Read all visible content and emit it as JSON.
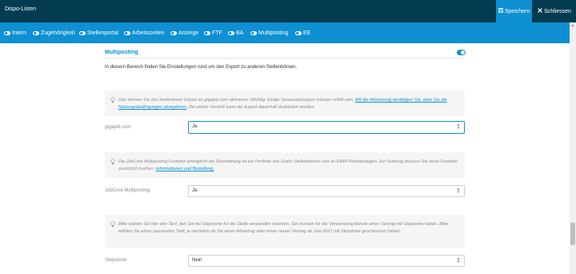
{
  "window": {
    "title": "Dispo-Listen",
    "save_label": "Speichern",
    "close_label": "Schliessen"
  },
  "tabs": [
    {
      "label": "Intern"
    },
    {
      "label": "Zugehörigkeit"
    },
    {
      "label": "Stellenportal"
    },
    {
      "label": "Arbeitszeiten"
    },
    {
      "label": "Anzeige"
    },
    {
      "label": "FTF"
    },
    {
      "label": "BA"
    },
    {
      "label": "Multiposting"
    },
    {
      "label": "EE"
    }
  ],
  "section": {
    "title": "Multiposting",
    "enabled": true,
    "intro": "In diesem Bereich finden Sie Einstellungen rund um den Export zu anderen Stellenbörsen."
  },
  "hints": {
    "gigajob": {
      "text_before": "Hier können Sie den kostenlosen Export an gigajob.com aktivieren. Wichtig: Einige Voraussetzungen müssen erfüllt sein. ",
      "link": "Mit der Aktivierung bestätigen Sie, dass Sie die Nutzungsbedingungen akzeptieren",
      "text_after": ", Bei einem Verstoß kann der Export dauerhaft deaktiviert werden."
    },
    "jobcore": {
      "text_before": "Die JobCore Multiposting-Funktion ermöglicht die Übermittlung an ein Portfolio von Gratis Stellenbörsen und an EBAY-Kleinanzeigen. Zur Nutzung müssen Sie diese Funktion zusätzlich buchen. ",
      "link": "Informationen und Bestellung."
    },
    "stepstone": {
      "text": "Bitte wählen Sie hier den Tarif, den Sie bei Stepstone für die Stelle verwenden möchten. Sie müssen für die Verwendung bereits einen Vertrag mit Stepstone haben. Bitte wählen Sie einen passenden Tarif, je nachdem ob Sie einen Altvertrag oder einen neuen Vertrag ab Juni 2021 mit Stepstone geschlossen haben."
    }
  },
  "fields": {
    "gigajob": {
      "label": "gigajob.com",
      "value": "Ja"
    },
    "jobcore": {
      "label": "JobCore Multiposting",
      "value": "Ja"
    },
    "stepstone": {
      "label": "Stepstone",
      "value": "Nein"
    }
  },
  "icons": {
    "save": "floppy-disk-icon",
    "close": "x-icon",
    "tab_toggle": "toggle-on-icon",
    "hint": "lightbulb-icon",
    "select_arrows": "chevron-up-down-icon"
  },
  "colors": {
    "topbar": "#033b50",
    "accent": "#0e90d2",
    "hint_bg": "#f5f5f5"
  }
}
